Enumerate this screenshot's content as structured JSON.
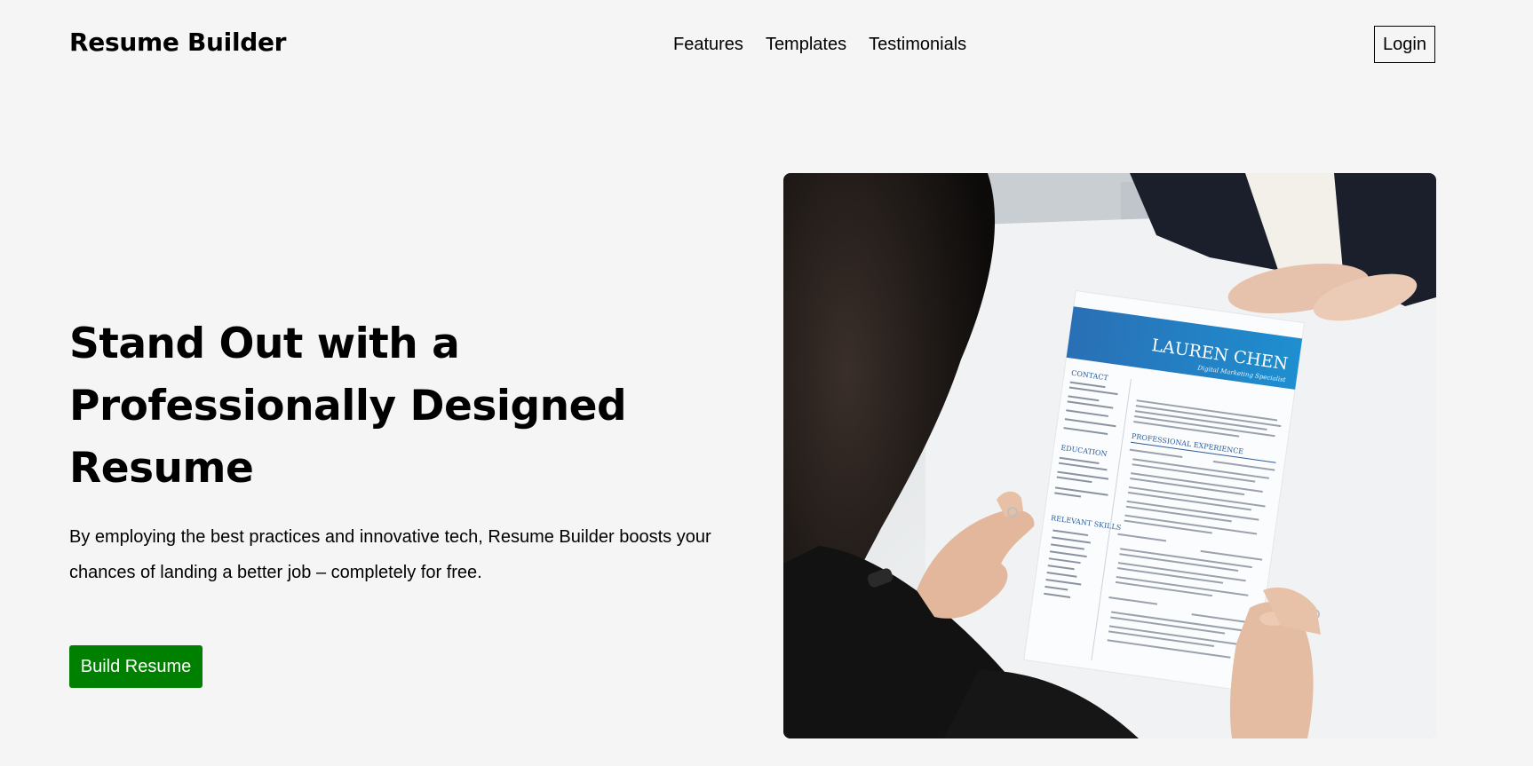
{
  "header": {
    "brand": "Resume Builder",
    "nav": [
      "Features",
      "Templates",
      "Testimonials"
    ],
    "login_label": "Login"
  },
  "hero": {
    "title": "Stand Out with a Professionally Designed Resume",
    "subtitle": "By employing the best practices and innovative tech, Resume Builder boosts your chances of landing a better job – completely for free.",
    "cta_label": "Build Resume"
  },
  "photo": {
    "resume_name": "LAUREN CHEN",
    "resume_role": "Digital Marketing Specialist",
    "sections": [
      "CONTACT",
      "EDUCATION",
      "RELEVANT SKILLS",
      "PROFESSIONAL EXPERIENCE"
    ]
  },
  "colors": {
    "background": "#f5f5f5",
    "cta": "#008000",
    "resume_banner": "#1f78c2"
  }
}
